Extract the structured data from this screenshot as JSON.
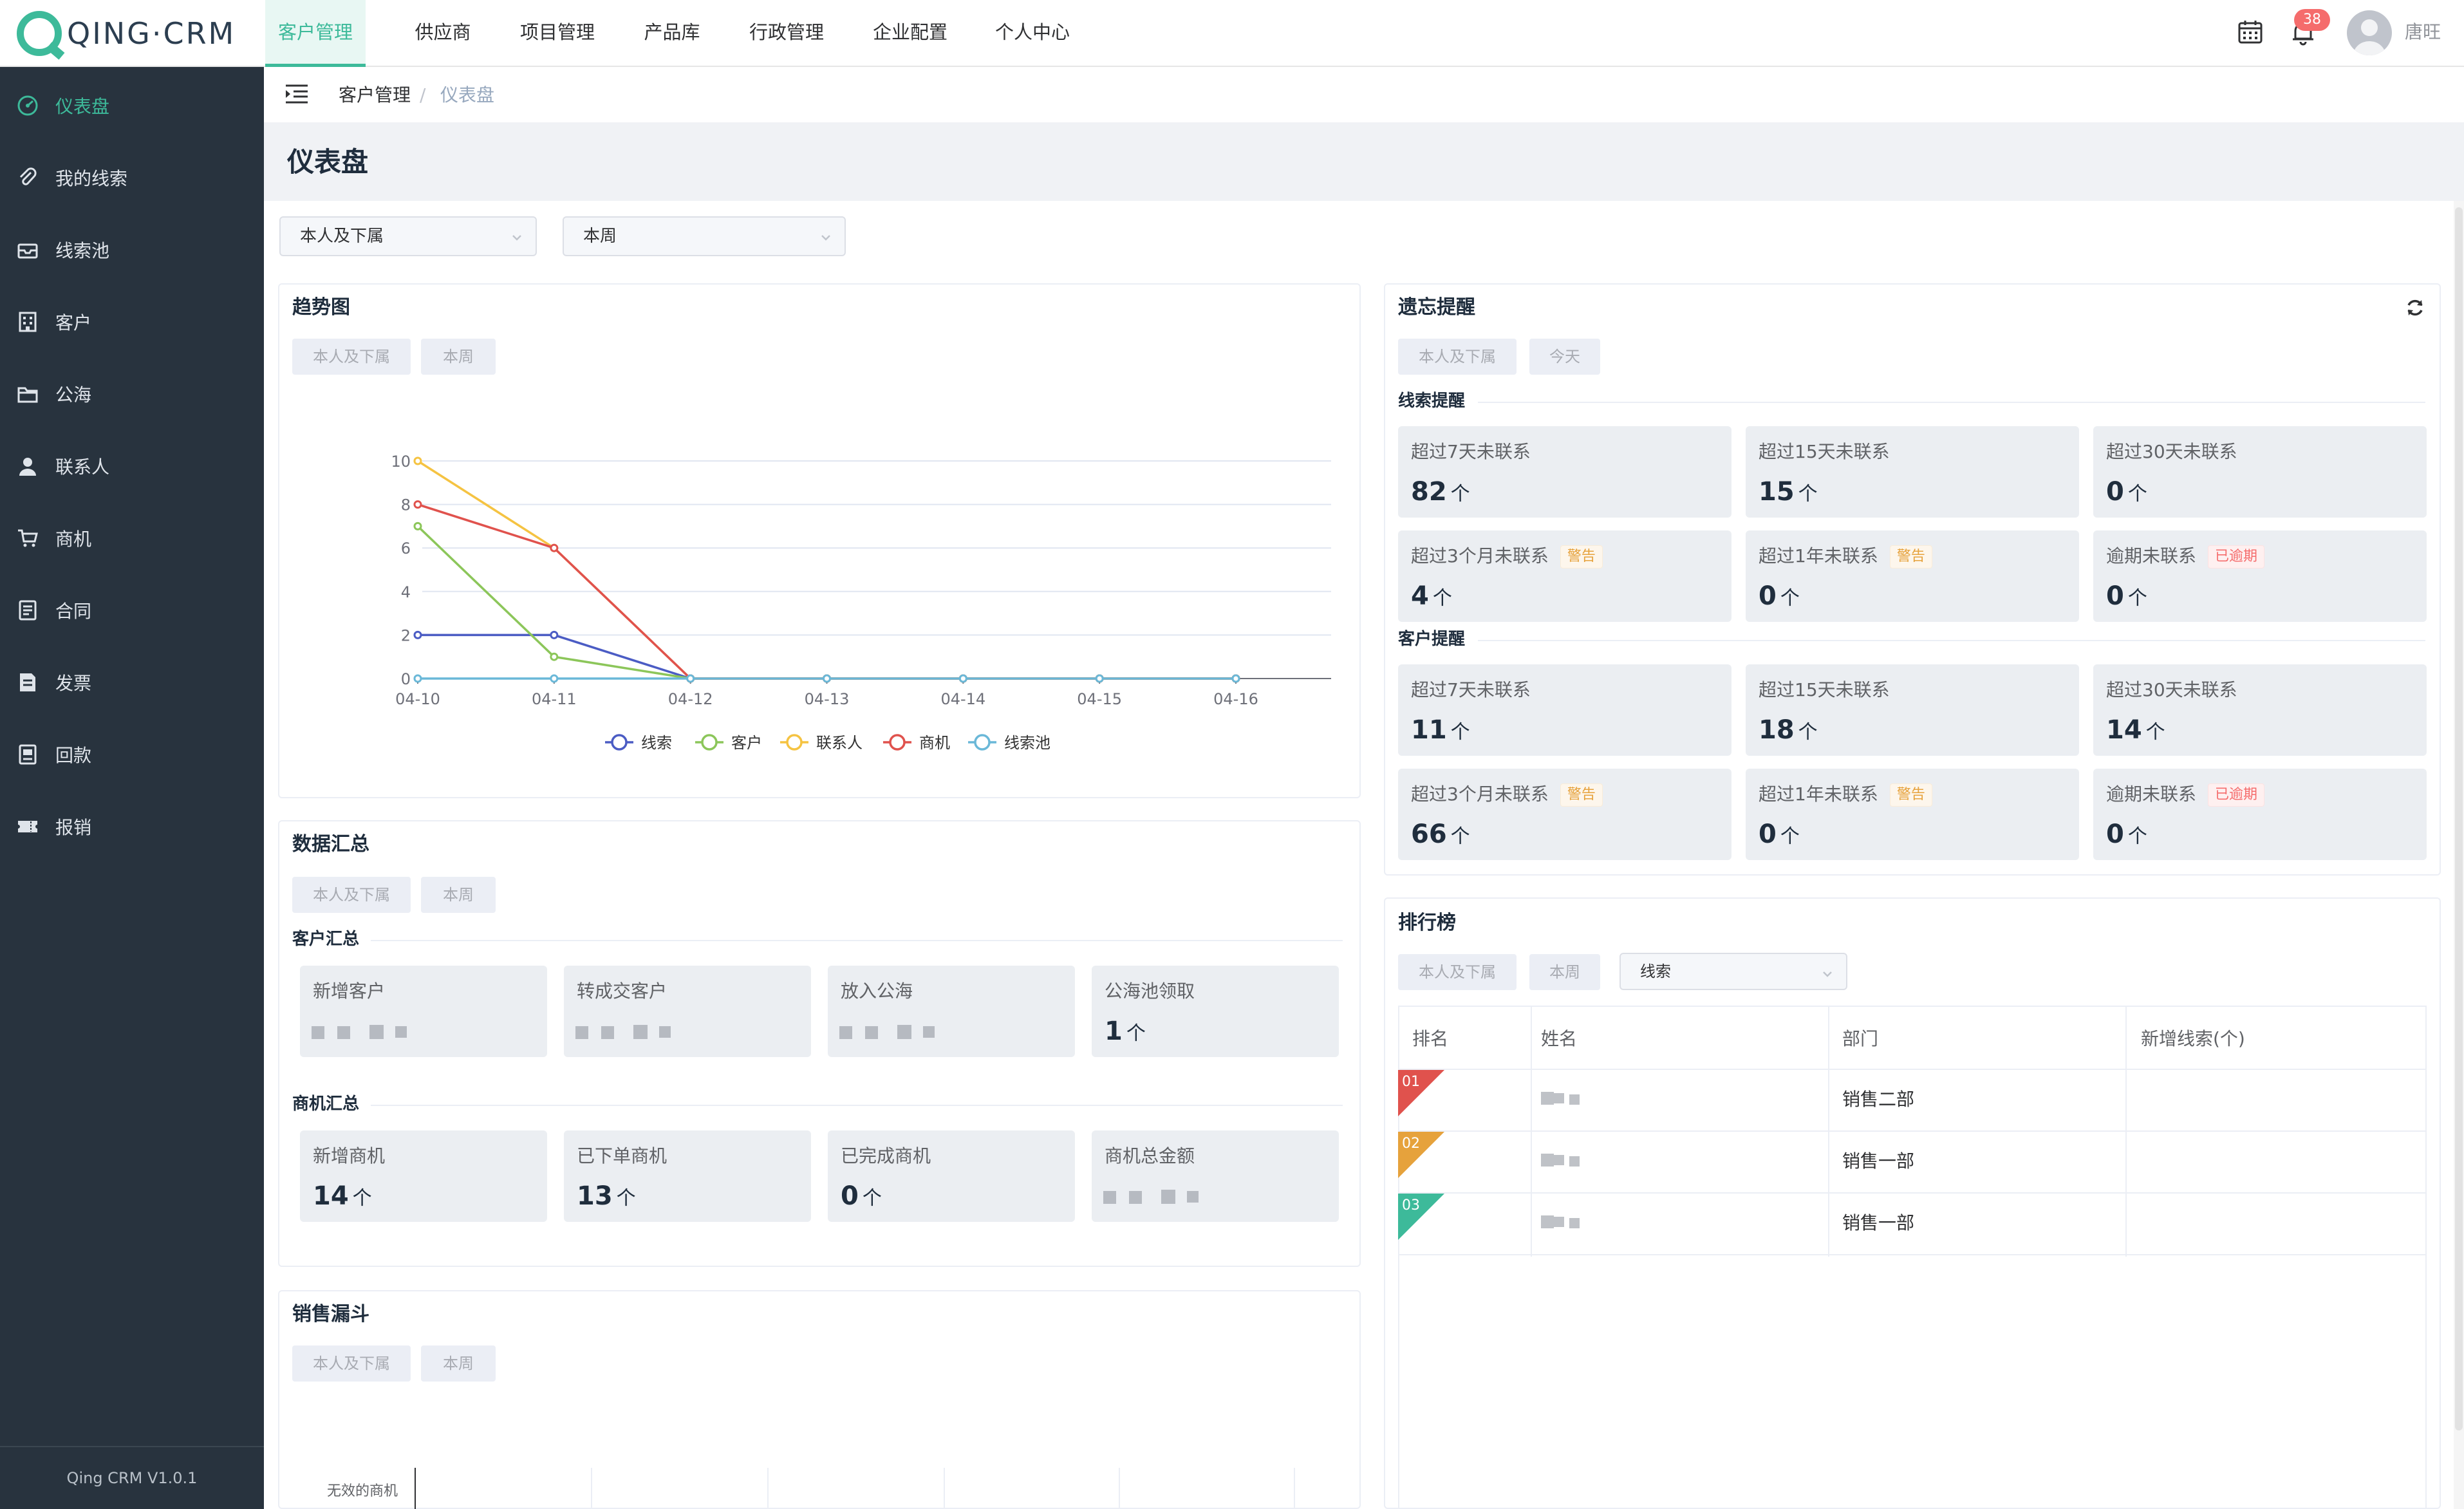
{
  "app": {
    "logo_text": "QING·CRM",
    "version": "Qing CRM V1.0.1",
    "notification_count": "38",
    "user_name": "唐旺",
    "accent_color": "#3dba9a",
    "sidebar_color": "#28333e"
  },
  "topnav": {
    "items": [
      "客户管理",
      "供应商",
      "项目管理",
      "产品库",
      "行政管理",
      "企业配置",
      "个人中心"
    ],
    "active": "客户管理"
  },
  "sidebar": {
    "items": [
      {
        "label": "仪表盘",
        "icon": "dashboard-icon"
      },
      {
        "label": "我的线索",
        "icon": "paperclip-icon"
      },
      {
        "label": "线索池",
        "icon": "inbox-icon"
      },
      {
        "label": "客户",
        "icon": "building-icon"
      },
      {
        "label": "公海",
        "icon": "folder-icon"
      },
      {
        "label": "联系人",
        "icon": "user-icon"
      },
      {
        "label": "商机",
        "icon": "cart-icon"
      },
      {
        "label": "合同",
        "icon": "document-icon"
      },
      {
        "label": "发票",
        "icon": "invoice-icon"
      },
      {
        "label": "回款",
        "icon": "receipt-icon"
      },
      {
        "label": "报销",
        "icon": "ticket-icon"
      }
    ],
    "active": "仪表盘"
  },
  "breadcrumb": {
    "parent": "客户管理",
    "separator": "/",
    "current": "仪表盘"
  },
  "page": {
    "title": "仪表盘"
  },
  "filters": {
    "scope": "本人及下属",
    "period": "本周"
  },
  "trend": {
    "title": "趋势图",
    "chip_scope": "本人及下属",
    "chip_period": "本周"
  },
  "chart_data": {
    "type": "line",
    "categories": [
      "04-10",
      "04-11",
      "04-12",
      "04-13",
      "04-14",
      "04-15",
      "04-16"
    ],
    "series": [
      {
        "name": "线索",
        "color": "#4b5cc4",
        "values": [
          2,
          2,
          0,
          0,
          0,
          0,
          0
        ]
      },
      {
        "name": "客户",
        "color": "#8cc65a",
        "values": [
          7,
          1,
          0,
          0,
          0,
          0,
          0
        ]
      },
      {
        "name": "联系人",
        "color": "#f5c342",
        "values": [
          10,
          6,
          0,
          0,
          0,
          0,
          0
        ]
      },
      {
        "name": "商机",
        "color": "#e0524d",
        "values": [
          8,
          6,
          0,
          0,
          0,
          0,
          0
        ]
      },
      {
        "name": "线索池",
        "color": "#6ab8d8",
        "values": [
          0,
          0,
          0,
          0,
          0,
          0,
          0
        ]
      }
    ],
    "y_ticks": [
      "0",
      "2",
      "4",
      "6",
      "8",
      "10"
    ],
    "ylim": [
      0,
      10
    ],
    "grid": true,
    "legend": "bottom"
  },
  "summary": {
    "title": "数据汇总",
    "chip_scope": "本人及下属",
    "chip_period": "本周",
    "customer_section": "客户汇总",
    "customer_cards": [
      {
        "label": "新增客户",
        "value": ""
      },
      {
        "label": "转成交客户",
        "value": ""
      },
      {
        "label": "放入公海",
        "value": ""
      },
      {
        "label": "公海池领取",
        "value": "1",
        "unit": "个"
      }
    ],
    "opportunity_section": "商机汇总",
    "opportunity_cards": [
      {
        "label": "新增商机",
        "value": "14",
        "unit": "个"
      },
      {
        "label": "已下单商机",
        "value": "13",
        "unit": "个"
      },
      {
        "label": "已完成商机",
        "value": "0",
        "unit": "个"
      },
      {
        "label": "商机总金额",
        "value": ""
      }
    ]
  },
  "funnel": {
    "title": "销售漏斗",
    "chip_scope": "本人及下属",
    "chip_period": "本周",
    "first_stage": "无效的商机"
  },
  "reminders": {
    "title": "遗忘提醒",
    "chip_scope": "本人及下属",
    "chip_period": "今天",
    "lead_section": "线索提醒",
    "lead_cards": [
      {
        "label": "超过7天未联系",
        "value": "82",
        "unit": "个",
        "tag": "",
        "tag_type": ""
      },
      {
        "label": "超过15天未联系",
        "value": "15",
        "unit": "个",
        "tag": "",
        "tag_type": ""
      },
      {
        "label": "超过30天未联系",
        "value": "0",
        "unit": "个",
        "tag": "",
        "tag_type": ""
      },
      {
        "label": "超过3个月未联系",
        "value": "4",
        "unit": "个",
        "tag": "警告",
        "tag_type": "warn"
      },
      {
        "label": "超过1年未联系",
        "value": "0",
        "unit": "个",
        "tag": "警告",
        "tag_type": "warn"
      },
      {
        "label": "逾期未联系",
        "value": "0",
        "unit": "个",
        "tag": "已逾期",
        "tag_type": "over"
      }
    ],
    "customer_section": "客户提醒",
    "customer_cards": [
      {
        "label": "超过7天未联系",
        "value": "11",
        "unit": "个",
        "tag": "",
        "tag_type": ""
      },
      {
        "label": "超过15天未联系",
        "value": "18",
        "unit": "个",
        "tag": "",
        "tag_type": ""
      },
      {
        "label": "超过30天未联系",
        "value": "14",
        "unit": "个",
        "tag": "",
        "tag_type": ""
      },
      {
        "label": "超过3个月未联系",
        "value": "66",
        "unit": "个",
        "tag": "警告",
        "tag_type": "warn"
      },
      {
        "label": "超过1年未联系",
        "value": "0",
        "unit": "个",
        "tag": "警告",
        "tag_type": "warn"
      },
      {
        "label": "逾期未联系",
        "value": "0",
        "unit": "个",
        "tag": "已逾期",
        "tag_type": "over"
      }
    ]
  },
  "ranking": {
    "title": "排行榜",
    "chip_scope": "本人及下属",
    "chip_period": "本周",
    "metric": "线索",
    "columns": [
      "排名",
      "姓名",
      "部门",
      "新增线索(个)"
    ],
    "rows": [
      {
        "rank": "01",
        "color": "#e0524d",
        "department": "销售二部"
      },
      {
        "rank": "02",
        "color": "#e6a23c",
        "department": "销售一部"
      },
      {
        "rank": "03",
        "color": "#3dba9a",
        "department": "销售一部"
      }
    ]
  }
}
